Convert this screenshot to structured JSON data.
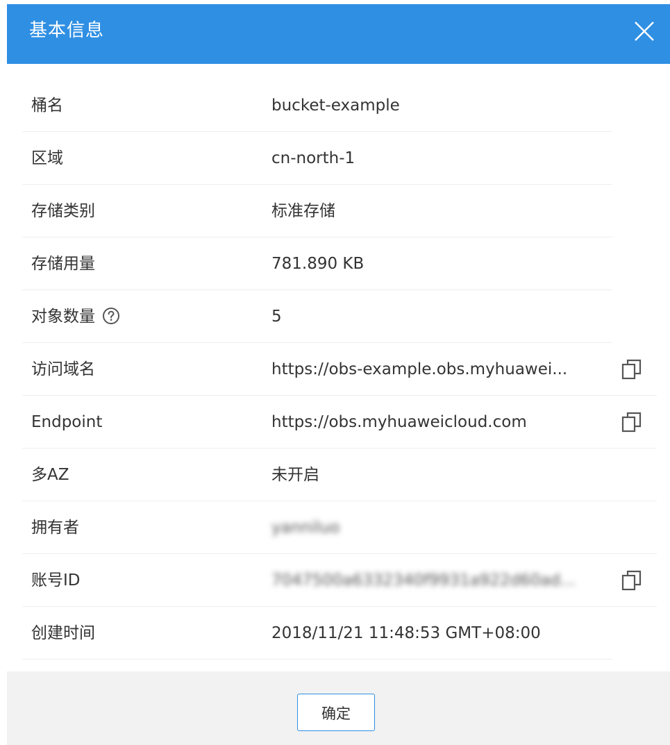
{
  "dialog": {
    "title": "基本信息",
    "close_icon": "close-icon"
  },
  "rows": [
    {
      "label": "桶名",
      "value": "bucket-example"
    },
    {
      "label": "区域",
      "value": "cn-north-1"
    },
    {
      "label": "存储类别",
      "value": "标准存储"
    },
    {
      "label": "存储用量",
      "value": "781.890 KB"
    },
    {
      "label": "对象数量",
      "value": "5",
      "icon": "help-icon"
    },
    {
      "label": "访问域名",
      "value": "https://obs-example.obs.myhuawei...",
      "icon": "copy-icon"
    },
    {
      "label": "Endpoint",
      "value": "https://obs.myhuaweicloud.com",
      "icon": "copy-icon"
    },
    {
      "label": "多AZ",
      "value": "未开启"
    },
    {
      "label": "拥有者",
      "value": "yanniluo",
      "blurred": true
    },
    {
      "label": "账号ID",
      "value": "7047500a6332340f9931a922d60ad...",
      "blurred": true,
      "icon": "copy-icon"
    },
    {
      "label": "创建时间",
      "value": "2018/11/21 11:48:53 GMT+08:00"
    }
  ],
  "footer": {
    "ok_label": "确定"
  },
  "colors": {
    "header_bg": "#2f8fe3",
    "footer_bg": "#f2f2f2",
    "button_border": "#2f8fe3"
  }
}
